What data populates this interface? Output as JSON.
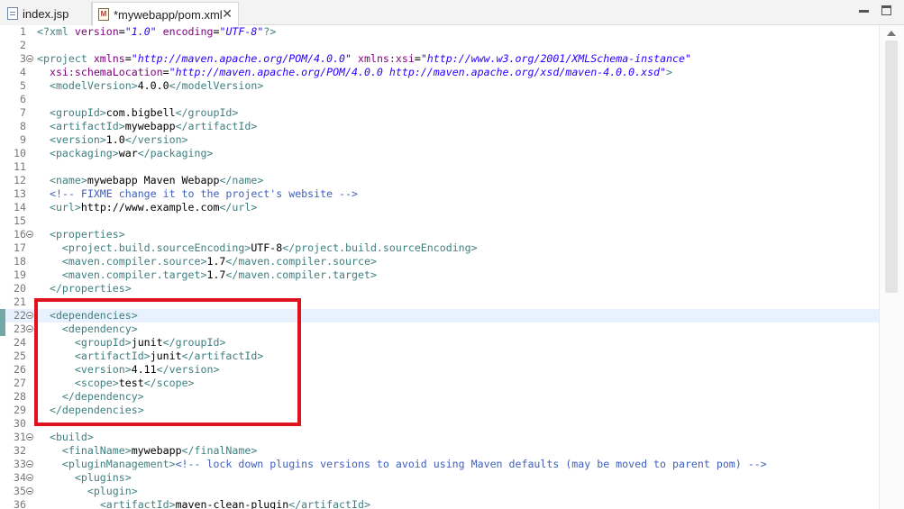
{
  "tabs": [
    {
      "label": "index.jsp",
      "icon": "jsp-file-icon",
      "active": false
    },
    {
      "label": "*mywebapp/pom.xml",
      "icon": "maven-xml-file-icon",
      "active": true
    }
  ],
  "close_glyph": "✕",
  "line_numbers": [
    "1",
    "2",
    "3",
    "4",
    "5",
    "6",
    "7",
    "8",
    "9",
    "10",
    "11",
    "12",
    "13",
    "14",
    "15",
    "16",
    "17",
    "18",
    "19",
    "20",
    "21",
    "22",
    "23",
    "24",
    "25",
    "26",
    "27",
    "28",
    "29",
    "30",
    "31",
    "32",
    "33",
    "34",
    "35",
    "36"
  ],
  "lines": [
    {
      "n": "1",
      "tokens": [
        {
          "t": "<?xml ",
          "c": "tag"
        },
        {
          "t": "version",
          "c": "attr"
        },
        {
          "t": "=",
          "c": ""
        },
        {
          "t": "\"1.0\"",
          "c": "str"
        },
        {
          "t": " ",
          "c": ""
        },
        {
          "t": "encoding",
          "c": "attr"
        },
        {
          "t": "=",
          "c": ""
        },
        {
          "t": "\"UTF-8\"",
          "c": "str"
        },
        {
          "t": "?>",
          "c": "tag"
        }
      ]
    },
    {
      "n": "2",
      "tokens": []
    },
    {
      "n": "3",
      "fold": true,
      "tokens": [
        {
          "t": "<project ",
          "c": "tag"
        },
        {
          "t": "xmlns",
          "c": "attr"
        },
        {
          "t": "=",
          "c": ""
        },
        {
          "t": "\"http://maven.apache.org/POM/4.0.0\"",
          "c": "str"
        },
        {
          "t": " ",
          "c": ""
        },
        {
          "t": "xmlns:xsi",
          "c": "attr"
        },
        {
          "t": "=",
          "c": ""
        },
        {
          "t": "\"http://www.w3.org/2001/XMLSchema-instance\"",
          "c": "str"
        }
      ]
    },
    {
      "n": "4",
      "tokens": [
        {
          "t": "  ",
          "c": ""
        },
        {
          "t": "xsi:schemaLocation",
          "c": "attr"
        },
        {
          "t": "=",
          "c": ""
        },
        {
          "t": "\"http://maven.apache.org/POM/4.0.0 http://maven.apache.org/xsd/maven-4.0.0.xsd\"",
          "c": "str"
        },
        {
          "t": ">",
          "c": "tag"
        }
      ]
    },
    {
      "n": "5",
      "tokens": [
        {
          "t": "  ",
          "c": ""
        },
        {
          "t": "<modelVersion>",
          "c": "tag"
        },
        {
          "t": "4.0.0",
          "c": ""
        },
        {
          "t": "</modelVersion>",
          "c": "tag"
        }
      ]
    },
    {
      "n": "6",
      "tokens": []
    },
    {
      "n": "7",
      "tokens": [
        {
          "t": "  ",
          "c": ""
        },
        {
          "t": "<groupId>",
          "c": "tag"
        },
        {
          "t": "com.bigbell",
          "c": ""
        },
        {
          "t": "</groupId>",
          "c": "tag"
        }
      ]
    },
    {
      "n": "8",
      "tokens": [
        {
          "t": "  ",
          "c": ""
        },
        {
          "t": "<artifactId>",
          "c": "tag"
        },
        {
          "t": "mywebapp",
          "c": ""
        },
        {
          "t": "</artifactId>",
          "c": "tag"
        }
      ]
    },
    {
      "n": "9",
      "tokens": [
        {
          "t": "  ",
          "c": ""
        },
        {
          "t": "<version>",
          "c": "tag"
        },
        {
          "t": "1.0",
          "c": ""
        },
        {
          "t": "</version>",
          "c": "tag"
        }
      ]
    },
    {
      "n": "10",
      "tokens": [
        {
          "t": "  ",
          "c": ""
        },
        {
          "t": "<packaging>",
          "c": "tag"
        },
        {
          "t": "war",
          "c": ""
        },
        {
          "t": "</packaging>",
          "c": "tag"
        }
      ]
    },
    {
      "n": "11",
      "tokens": []
    },
    {
      "n": "12",
      "tokens": [
        {
          "t": "  ",
          "c": ""
        },
        {
          "t": "<name>",
          "c": "tag"
        },
        {
          "t": "mywebapp Maven Webapp",
          "c": ""
        },
        {
          "t": "</name>",
          "c": "tag"
        }
      ]
    },
    {
      "n": "13",
      "tokens": [
        {
          "t": "  ",
          "c": ""
        },
        {
          "t": "<!-- FIXME change it to the project's website -->",
          "c": "cmt"
        }
      ]
    },
    {
      "n": "14",
      "tokens": [
        {
          "t": "  ",
          "c": ""
        },
        {
          "t": "<url>",
          "c": "tag"
        },
        {
          "t": "http://www.example.com",
          "c": ""
        },
        {
          "t": "</url>",
          "c": "tag"
        }
      ]
    },
    {
      "n": "15",
      "tokens": []
    },
    {
      "n": "16",
      "fold": true,
      "tokens": [
        {
          "t": "  ",
          "c": ""
        },
        {
          "t": "<properties>",
          "c": "tag"
        }
      ]
    },
    {
      "n": "17",
      "tokens": [
        {
          "t": "    ",
          "c": ""
        },
        {
          "t": "<project.build.sourceEncoding>",
          "c": "tag"
        },
        {
          "t": "UTF-8",
          "c": ""
        },
        {
          "t": "</project.build.sourceEncoding>",
          "c": "tag"
        }
      ]
    },
    {
      "n": "18",
      "tokens": [
        {
          "t": "    ",
          "c": ""
        },
        {
          "t": "<maven.compiler.source>",
          "c": "tag"
        },
        {
          "t": "1.7",
          "c": ""
        },
        {
          "t": "</maven.compiler.source>",
          "c": "tag"
        }
      ]
    },
    {
      "n": "19",
      "tokens": [
        {
          "t": "    ",
          "c": ""
        },
        {
          "t": "<maven.compiler.target>",
          "c": "tag"
        },
        {
          "t": "1.7",
          "c": ""
        },
        {
          "t": "</maven.compiler.target>",
          "c": "tag"
        }
      ]
    },
    {
      "n": "20",
      "tokens": [
        {
          "t": "  ",
          "c": ""
        },
        {
          "t": "</properties>",
          "c": "tag"
        }
      ]
    },
    {
      "n": "21",
      "tokens": []
    },
    {
      "n": "22",
      "fold": true,
      "current": true,
      "marked": true,
      "tokens": [
        {
          "t": "  ",
          "c": ""
        },
        {
          "t": "<dependencies>",
          "c": "tag"
        }
      ]
    },
    {
      "n": "23",
      "fold": true,
      "marked": true,
      "tokens": [
        {
          "t": "    ",
          "c": ""
        },
        {
          "t": "<dependency>",
          "c": "tag"
        }
      ]
    },
    {
      "n": "24",
      "tokens": [
        {
          "t": "      ",
          "c": ""
        },
        {
          "t": "<groupId>",
          "c": "tag"
        },
        {
          "t": "junit",
          "c": ""
        },
        {
          "t": "</groupId>",
          "c": "tag"
        }
      ]
    },
    {
      "n": "25",
      "tokens": [
        {
          "t": "      ",
          "c": ""
        },
        {
          "t": "<artifactId>",
          "c": "tag"
        },
        {
          "t": "junit",
          "c": ""
        },
        {
          "t": "</artifactId>",
          "c": "tag"
        }
      ]
    },
    {
      "n": "26",
      "tokens": [
        {
          "t": "      ",
          "c": ""
        },
        {
          "t": "<version>",
          "c": "tag"
        },
        {
          "t": "4.11",
          "c": ""
        },
        {
          "t": "</version>",
          "c": "tag"
        }
      ]
    },
    {
      "n": "27",
      "tokens": [
        {
          "t": "      ",
          "c": ""
        },
        {
          "t": "<scope>",
          "c": "tag"
        },
        {
          "t": "test",
          "c": ""
        },
        {
          "t": "</scope>",
          "c": "tag"
        }
      ]
    },
    {
      "n": "28",
      "tokens": [
        {
          "t": "    ",
          "c": ""
        },
        {
          "t": "</dependency>",
          "c": "tag"
        }
      ]
    },
    {
      "n": "29",
      "tokens": [
        {
          "t": "  ",
          "c": ""
        },
        {
          "t": "</dependencies>",
          "c": "tag"
        }
      ]
    },
    {
      "n": "30",
      "tokens": []
    },
    {
      "n": "31",
      "fold": true,
      "tokens": [
        {
          "t": "  ",
          "c": ""
        },
        {
          "t": "<build>",
          "c": "tag"
        }
      ]
    },
    {
      "n": "32",
      "tokens": [
        {
          "t": "    ",
          "c": ""
        },
        {
          "t": "<finalName>",
          "c": "tag"
        },
        {
          "t": "mywebapp",
          "c": ""
        },
        {
          "t": "</finalName>",
          "c": "tag"
        }
      ]
    },
    {
      "n": "33",
      "fold": true,
      "tokens": [
        {
          "t": "    ",
          "c": ""
        },
        {
          "t": "<pluginManagement>",
          "c": "tag"
        },
        {
          "t": "<!-- lock down plugins versions to avoid using Maven defaults (may be moved to parent pom) -->",
          "c": "cmt"
        }
      ]
    },
    {
      "n": "34",
      "fold": true,
      "tokens": [
        {
          "t": "      ",
          "c": ""
        },
        {
          "t": "<plugins>",
          "c": "tag"
        }
      ]
    },
    {
      "n": "35",
      "fold": true,
      "tokens": [
        {
          "t": "        ",
          "c": ""
        },
        {
          "t": "<plugin>",
          "c": "tag"
        }
      ]
    },
    {
      "n": "36",
      "tokens": [
        {
          "t": "          ",
          "c": ""
        },
        {
          "t": "<artifactId>",
          "c": "tag"
        },
        {
          "t": "maven-clean-plugin",
          "c": ""
        },
        {
          "t": "</artifactId>",
          "c": "tag"
        }
      ]
    }
  ],
  "highlight_color": "#e0121e"
}
